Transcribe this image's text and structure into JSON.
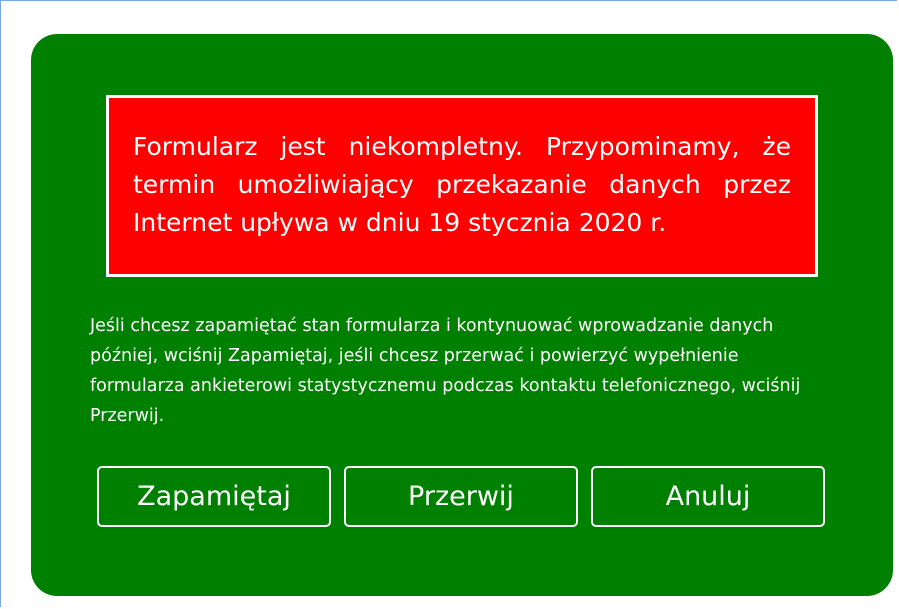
{
  "dialog": {
    "alert_text": "Formularz jest niekompletny. Przypominamy, że termin umożliwiający przekazanie danych przez Internet upływa w dniu 19 stycznia 2020 r.",
    "info_text": "Jeśli chcesz zapamiętać stan formularza i kontynuować wprowadzanie danych później, wciśnij Zapamiętaj, jeśli chcesz przerwać i powierzyć wypełnienie formularza ankieterowi statystycznemu podczas kontaktu telefonicznego, wciśnij Przerwij.",
    "buttons": {
      "save_label": "Zapamiętaj",
      "stop_label": "Przerwij",
      "cancel_label": "Anuluj"
    }
  },
  "colors": {
    "dialog_bg": "#008000",
    "alert_bg": "#ff0000",
    "text": "#ffffff",
    "window_border": "#7aa7e8"
  }
}
